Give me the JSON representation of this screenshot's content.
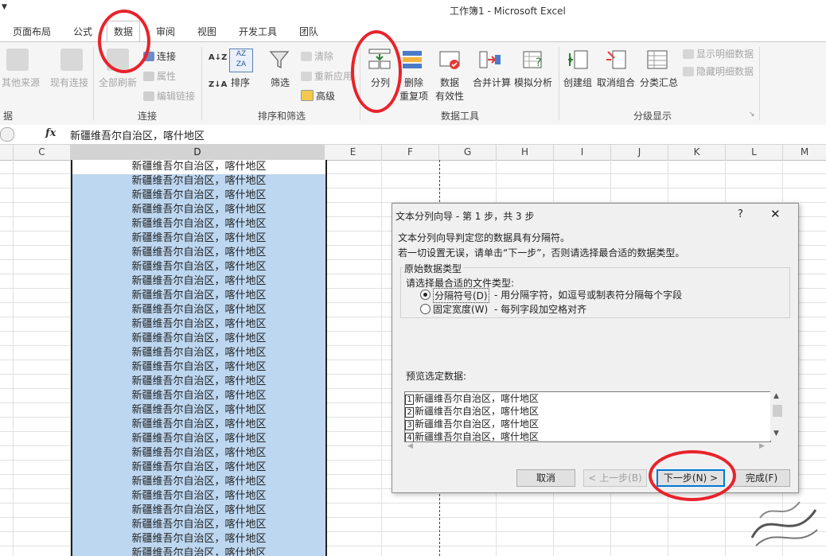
{
  "window": {
    "title": "工作簿1 - Microsoft Excel"
  },
  "tabs": [
    "页面布局",
    "公式",
    "数据",
    "审阅",
    "视图",
    "开发工具",
    "团队"
  ],
  "ribbon": {
    "get_external": {
      "other_sources": "其他来源",
      "existing": "现有连接",
      "group_label": "据"
    },
    "connections": {
      "refresh_all": "全部刷新",
      "connections": "连接",
      "properties": "属性",
      "edit_links": "编辑链接",
      "group_label": "连接"
    },
    "sort_filter": {
      "sort_az": "A↓Z",
      "sort_za": "Z↓A",
      "sort": "排序",
      "filter": "筛选",
      "clear": "清除",
      "reapply": "重新应用",
      "advanced": "高级",
      "group_label": "排序和筛选"
    },
    "data_tools": {
      "text_to_columns": "分列",
      "remove_dup_1": "删除",
      "remove_dup_2": "重复项",
      "validation_1": "数据",
      "validation_2": "有效性",
      "consolidate": "合并计算",
      "what_if": "模拟分析",
      "group_label": "数据工具"
    },
    "outline": {
      "group": "创建组",
      "ungroup": "取消组合",
      "subtotal": "分类汇总",
      "show_detail": "显示明细数据",
      "hide_detail": "隐藏明细数据",
      "group_label": "分级显示"
    }
  },
  "formula_bar": {
    "fx": "fx",
    "value": "新疆维吾尔自治区，喀什地区"
  },
  "columns": [
    "C",
    "D",
    "E",
    "F",
    "G",
    "H",
    "I",
    "J",
    "K",
    "L",
    "M"
  ],
  "cell_value": "新疆维吾尔自治区，喀什地区",
  "dialog": {
    "title": "文本分列向导 - 第 1 步，共 3 步",
    "help": "?",
    "close": "✕",
    "intro1": "文本分列向导判定您的数据具有分隔符。",
    "intro2": "若一切设置无误，请单击“下一步”，否则请选择最合适的数据类型。",
    "group_title": "原始数据类型",
    "choose_label": "请选择最合适的文件类型:",
    "opt_delimited": "分隔符号(D)",
    "opt_delimited_desc": "- 用分隔字符，如逗号或制表符分隔每个字段",
    "opt_fixed": "固定宽度(W)",
    "opt_fixed_desc": "- 每列字段加空格对齐",
    "preview_label": "预览选定数据:",
    "preview_lines": [
      {
        "num": "1",
        "text": "新疆维吾尔自治区，喀什地区"
      },
      {
        "num": "2",
        "text": "新疆维吾尔自治区，喀什地区"
      },
      {
        "num": "3",
        "text": "新疆维吾尔自治区，喀什地区"
      },
      {
        "num": "4",
        "text": "新疆维吾尔自治区，喀什地区"
      }
    ],
    "cancel": "取消",
    "back": "< 上一步(B)",
    "next": "下一步(N) >",
    "finish": "完成(F)"
  },
  "colors": {
    "selection": "#bdd7f0",
    "annotation": "#e8232a",
    "ribbon_bg": "#f5f5f5"
  }
}
